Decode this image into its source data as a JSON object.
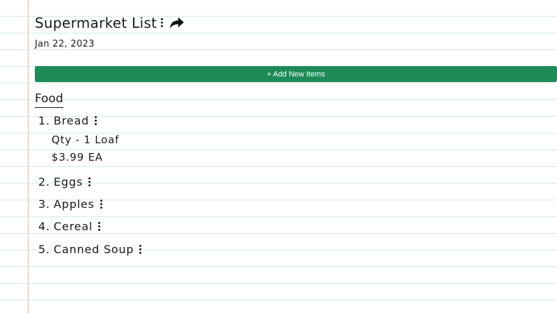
{
  "header": {
    "title": "Supermarket List",
    "date": "Jan 22, 2023"
  },
  "toolbar": {
    "add_label": "+ Add New Items"
  },
  "section": {
    "title": "Food"
  },
  "items": [
    {
      "number": "1.",
      "name": "Bread",
      "qty": "Qty - 1 Loaf",
      "price": "$3.99 EA"
    },
    {
      "number": "2.",
      "name": "Eggs"
    },
    {
      "number": "3.",
      "name": "Apples"
    },
    {
      "number": "4.",
      "name": "Cereal"
    },
    {
      "number": "5.",
      "name": "Canned Soup"
    }
  ],
  "colors": {
    "accent": "#1e8a57",
    "ruled_line": "#d3ece8",
    "margin_line": "#e0b7a8"
  },
  "icons": {
    "menu": "kebab-menu-icon",
    "share": "share-arrow-icon"
  }
}
